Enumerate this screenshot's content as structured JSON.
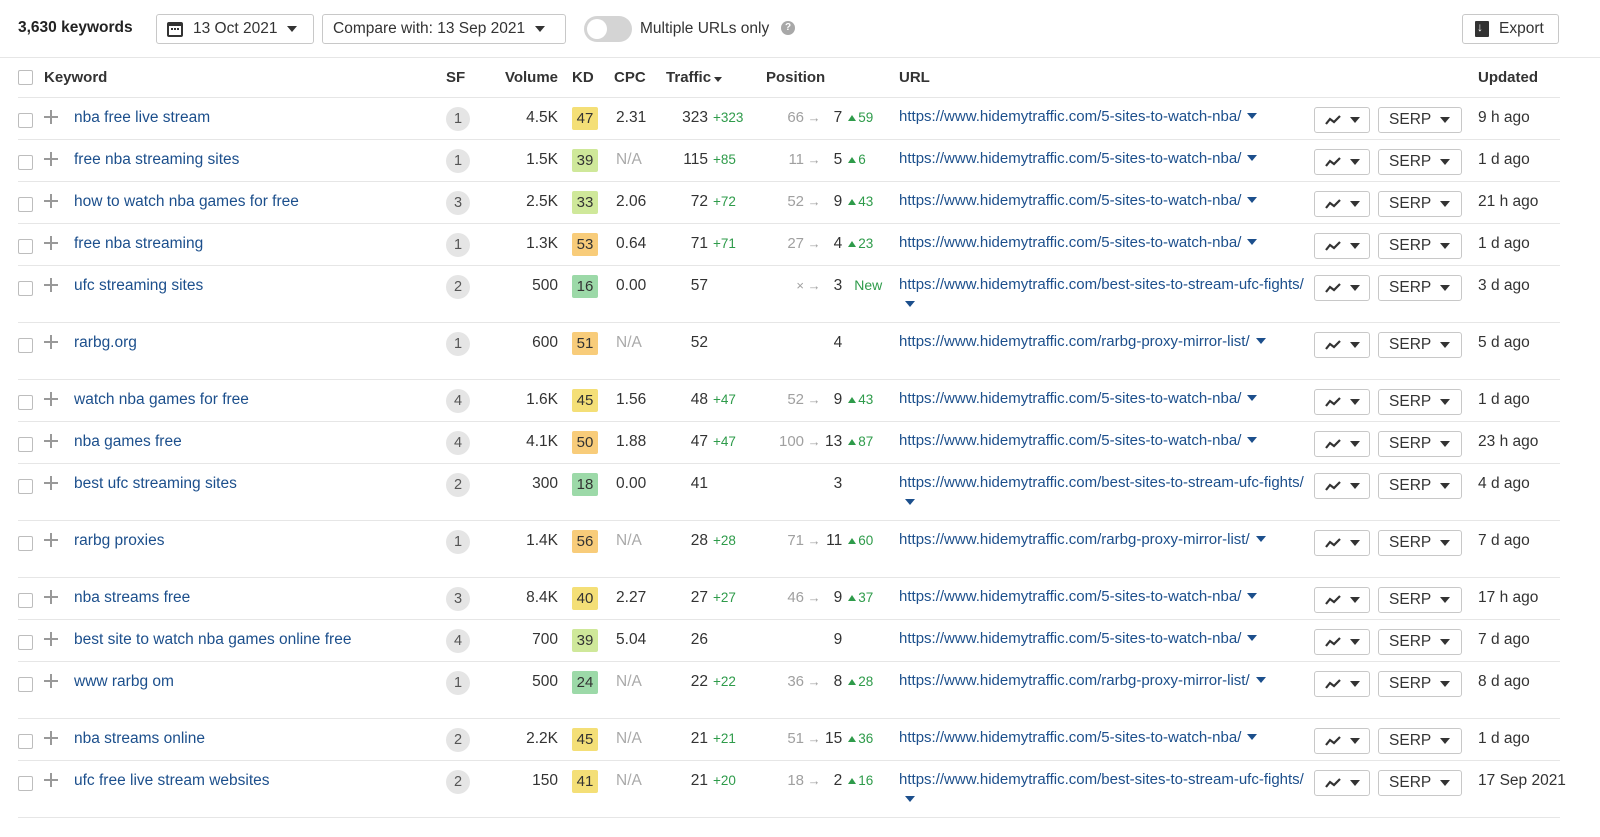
{
  "toolbar": {
    "keyword_count": "3,630 keywords",
    "date": "13 Oct 2021",
    "compare": "Compare with: 13 Sep 2021",
    "toggle_label": "Multiple URLs only",
    "toggle_on": false,
    "export": "Export"
  },
  "columns": {
    "keyword": "Keyword",
    "sf": "SF",
    "volume": "Volume",
    "kd": "KD",
    "cpc": "CPC",
    "traffic": "Traffic",
    "position": "Position",
    "url": "URL",
    "updated": "Updated"
  },
  "buttons": {
    "serp": "SERP"
  },
  "kd_colors": {
    "green": "#9cd9a8",
    "lime": "#cfe89a",
    "yellow": "#f4df77",
    "orange": "#f8cc7a"
  },
  "rows": [
    {
      "keyword": "nba free live stream",
      "sf": "1",
      "volume": "4.5K",
      "kd": "47",
      "kd_color": "yellow",
      "cpc": "2.31",
      "traffic": "323",
      "traffic_delta": "+323",
      "pos_old": "66",
      "pos_new": "7",
      "pos_delta": "59",
      "url": "https://www.hidemytraffic.com/5-sites-to-watch-nba/",
      "updated": "9 h ago",
      "tall": false
    },
    {
      "keyword": "free nba streaming sites",
      "sf": "1",
      "volume": "1.5K",
      "kd": "39",
      "kd_color": "lime",
      "cpc": "N/A",
      "traffic": "115",
      "traffic_delta": "+85",
      "pos_old": "11",
      "pos_new": "5",
      "pos_delta": "6",
      "url": "https://www.hidemytraffic.com/5-sites-to-watch-nba/",
      "updated": "1 d ago",
      "tall": false
    },
    {
      "keyword": "how to watch nba games for free",
      "sf": "3",
      "volume": "2.5K",
      "kd": "33",
      "kd_color": "lime",
      "cpc": "2.06",
      "traffic": "72",
      "traffic_delta": "+72",
      "pos_old": "52",
      "pos_new": "9",
      "pos_delta": "43",
      "url": "https://www.hidemytraffic.com/5-sites-to-watch-nba/",
      "updated": "21 h ago",
      "tall": false
    },
    {
      "keyword": "free nba streaming",
      "sf": "1",
      "volume": "1.3K",
      "kd": "53",
      "kd_color": "orange",
      "cpc": "0.64",
      "traffic": "71",
      "traffic_delta": "+71",
      "pos_old": "27",
      "pos_new": "4",
      "pos_delta": "23",
      "url": "https://www.hidemytraffic.com/5-sites-to-watch-nba/",
      "updated": "1 d ago",
      "tall": false
    },
    {
      "keyword": "ufc streaming sites",
      "sf": "2",
      "volume": "500",
      "kd": "16",
      "kd_color": "green",
      "cpc": "0.00",
      "traffic": "57",
      "traffic_delta": "",
      "pos_old": "×",
      "pos_new": "3",
      "pos_delta": "New",
      "url": "https://www.hidemytraffic.com/best-sites-to-stream-ufc-fights/",
      "updated": "3 d ago",
      "tall": true
    },
    {
      "keyword": "rarbg.org",
      "sf": "1",
      "volume": "600",
      "kd": "51",
      "kd_color": "orange",
      "cpc": "N/A",
      "traffic": "52",
      "traffic_delta": "",
      "pos_old": "",
      "pos_new": "4",
      "pos_delta": "",
      "url": "https://www.hidemytraffic.com/rarbg-proxy-mirror-list/",
      "updated": "5 d ago",
      "tall": true
    },
    {
      "keyword": "watch nba games for free",
      "sf": "4",
      "volume": "1.6K",
      "kd": "45",
      "kd_color": "yellow",
      "cpc": "1.56",
      "traffic": "48",
      "traffic_delta": "+47",
      "pos_old": "52",
      "pos_new": "9",
      "pos_delta": "43",
      "url": "https://www.hidemytraffic.com/5-sites-to-watch-nba/",
      "updated": "1 d ago",
      "tall": false
    },
    {
      "keyword": "nba games free",
      "sf": "4",
      "volume": "4.1K",
      "kd": "50",
      "kd_color": "orange",
      "cpc": "1.88",
      "traffic": "47",
      "traffic_delta": "+47",
      "pos_old": "100",
      "pos_new": "13",
      "pos_delta": "87",
      "url": "https://www.hidemytraffic.com/5-sites-to-watch-nba/",
      "updated": "23 h ago",
      "tall": false
    },
    {
      "keyword": "best ufc streaming sites",
      "sf": "2",
      "volume": "300",
      "kd": "18",
      "kd_color": "green",
      "cpc": "0.00",
      "traffic": "41",
      "traffic_delta": "",
      "pos_old": "",
      "pos_new": "3",
      "pos_delta": "",
      "url": "https://www.hidemytraffic.com/best-sites-to-stream-ufc-fights/",
      "updated": "4 d ago",
      "tall": true
    },
    {
      "keyword": "rarbg proxies",
      "sf": "1",
      "volume": "1.4K",
      "kd": "56",
      "kd_color": "orange",
      "cpc": "N/A",
      "traffic": "28",
      "traffic_delta": "+28",
      "pos_old": "71",
      "pos_new": "11",
      "pos_delta": "60",
      "url": "https://www.hidemytraffic.com/rarbg-proxy-mirror-list/",
      "updated": "7 d ago",
      "tall": true
    },
    {
      "keyword": "nba streams free",
      "sf": "3",
      "volume": "8.4K",
      "kd": "40",
      "kd_color": "yellow",
      "cpc": "2.27",
      "traffic": "27",
      "traffic_delta": "+27",
      "pos_old": "46",
      "pos_new": "9",
      "pos_delta": "37",
      "url": "https://www.hidemytraffic.com/5-sites-to-watch-nba/",
      "updated": "17 h ago",
      "tall": false
    },
    {
      "keyword": "best site to watch nba games online free",
      "sf": "4",
      "volume": "700",
      "kd": "39",
      "kd_color": "lime",
      "cpc": "5.04",
      "traffic": "26",
      "traffic_delta": "",
      "pos_old": "",
      "pos_new": "9",
      "pos_delta": "",
      "url": "https://www.hidemytraffic.com/5-sites-to-watch-nba/",
      "updated": "7 d ago",
      "tall": false
    },
    {
      "keyword": "www rarbg om",
      "sf": "1",
      "volume": "500",
      "kd": "24",
      "kd_color": "green",
      "cpc": "N/A",
      "traffic": "22",
      "traffic_delta": "+22",
      "pos_old": "36",
      "pos_new": "8",
      "pos_delta": "28",
      "url": "https://www.hidemytraffic.com/rarbg-proxy-mirror-list/",
      "updated": "8 d ago",
      "tall": true
    },
    {
      "keyword": "nba streams online",
      "sf": "2",
      "volume": "2.2K",
      "kd": "45",
      "kd_color": "yellow",
      "cpc": "N/A",
      "traffic": "21",
      "traffic_delta": "+21",
      "pos_old": "51",
      "pos_new": "15",
      "pos_delta": "36",
      "url": "https://www.hidemytraffic.com/5-sites-to-watch-nba/",
      "updated": "1 d ago",
      "tall": false
    },
    {
      "keyword": "ufc free live stream websites",
      "sf": "2",
      "volume": "150",
      "kd": "41",
      "kd_color": "yellow",
      "cpc": "N/A",
      "traffic": "21",
      "traffic_delta": "+20",
      "pos_old": "18",
      "pos_new": "2",
      "pos_delta": "16",
      "url": "https://www.hidemytraffic.com/best-sites-to-stream-ufc-fights/",
      "updated": "17 Sep 2021",
      "tall": true
    }
  ]
}
